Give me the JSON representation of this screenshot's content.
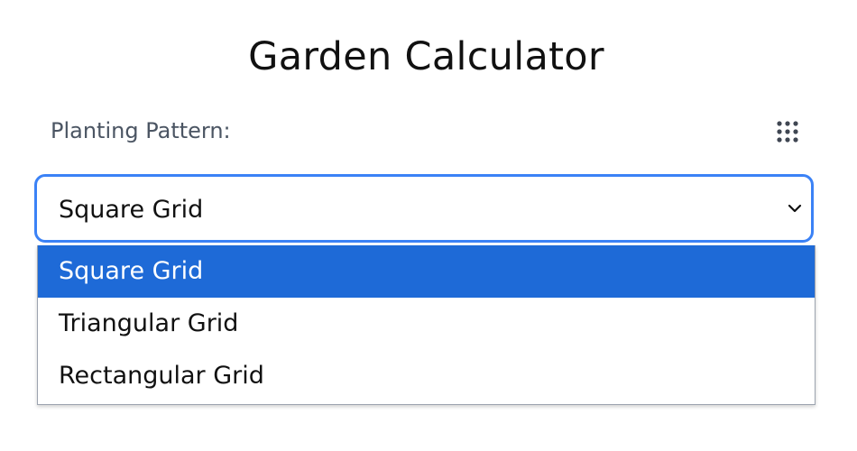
{
  "title": "Garden Calculator",
  "pattern_field": {
    "label": "Planting Pattern:",
    "icon": "grid-dots-icon",
    "selected_value": "Square Grid",
    "options": [
      "Square Grid",
      "Triangular Grid",
      "Rectangular Grid"
    ],
    "highlighted_index": 0
  },
  "colors": {
    "focus_border": "#3b82f6",
    "highlight": "#1e6ad7",
    "text": "#111111",
    "label": "#4b5563"
  }
}
